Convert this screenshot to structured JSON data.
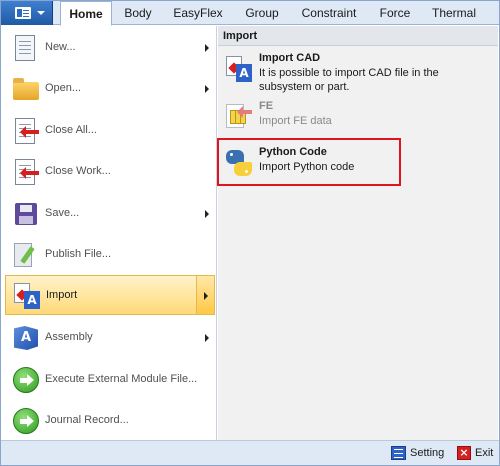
{
  "tabs": [
    {
      "label": "Home",
      "active": true
    },
    {
      "label": "Body"
    },
    {
      "label": "EasyFlex"
    },
    {
      "label": "Group"
    },
    {
      "label": "Constraint"
    },
    {
      "label": "Force"
    },
    {
      "label": "Thermal"
    }
  ],
  "menu": {
    "items": [
      {
        "label": "New...",
        "icon": "new-document-icon",
        "submenu": true
      },
      {
        "label": "Open...",
        "icon": "open-folder-icon",
        "submenu": true
      },
      {
        "label": "Close All...",
        "icon": "close-all-icon",
        "submenu": false
      },
      {
        "label": "Close Work...",
        "icon": "close-work-icon",
        "submenu": false
      },
      {
        "label": "Save...",
        "icon": "save-icon",
        "submenu": true
      },
      {
        "label": "Publish File...",
        "icon": "publish-file-icon",
        "submenu": false
      },
      {
        "label": "Import",
        "icon": "import-icon",
        "submenu": true,
        "active": true
      },
      {
        "label": "Assembly",
        "icon": "assembly-icon",
        "submenu": true
      },
      {
        "label": "Execute External Module File...",
        "icon": "execute-icon",
        "submenu": false
      },
      {
        "label": "Journal Record...",
        "icon": "journal-record-icon",
        "submenu": false
      }
    ]
  },
  "submenu": {
    "header": "Import",
    "items": [
      {
        "title": "Import CAD",
        "desc": "It is possible to import CAD file in the subsystem or part.",
        "icon": "import-cad-icon",
        "enabled": true
      },
      {
        "title": "FE",
        "desc": "Import FE data",
        "icon": "fe-icon",
        "enabled": false
      },
      {
        "title": "Python Code",
        "desc": "Import Python code",
        "icon": "python-icon",
        "enabled": true,
        "highlighted": true
      }
    ]
  },
  "bottom": {
    "setting_label": "Setting",
    "exit_label": "Exit"
  },
  "colors": {
    "highlight_border": "#e0141e",
    "active_item": "#ffd978",
    "tabbar": "#dfe9f6"
  }
}
